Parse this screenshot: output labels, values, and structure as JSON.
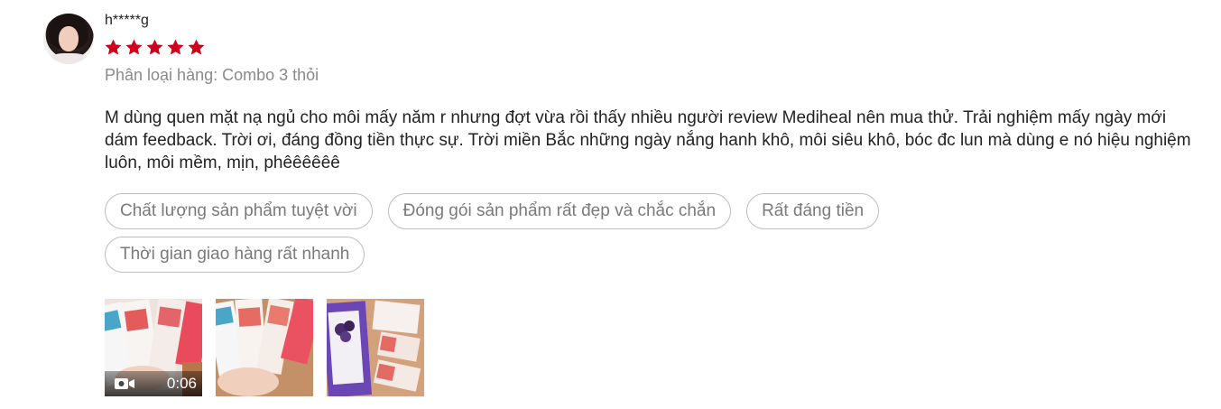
{
  "review": {
    "username": "h*****g",
    "rating": 5,
    "star_color": "#d0011b",
    "variation": "Phân loại hàng: Combo 3 thỏi",
    "comment": "M dùng quen mặt nạ ngủ cho môi mấy năm r nhưng đợt vừa rồi thấy nhiều người review Mediheal nên mua thử. Trải nghiệm mấy ngày mới dám feedback. Trời ơi, đáng đồng tiền thực sự. Trời miền Bắc những ngày nắng hanh khô, môi siêu khô, bóc đc lun mà dùng e nó hiệu nghiệm luôn, môi mềm, mịn, phêêêêêê",
    "tags": [
      "Chất lượng sản phẩm tuyệt vời",
      "Đóng gói sản phẩm rất đẹp và chắc chắn",
      "Rất đáng tiền",
      "Thời gian giao hàng rất nhanh"
    ],
    "media": [
      {
        "type": "video",
        "duration": "0:06",
        "icon": "video-camera-icon"
      },
      {
        "type": "image"
      },
      {
        "type": "image"
      }
    ]
  }
}
